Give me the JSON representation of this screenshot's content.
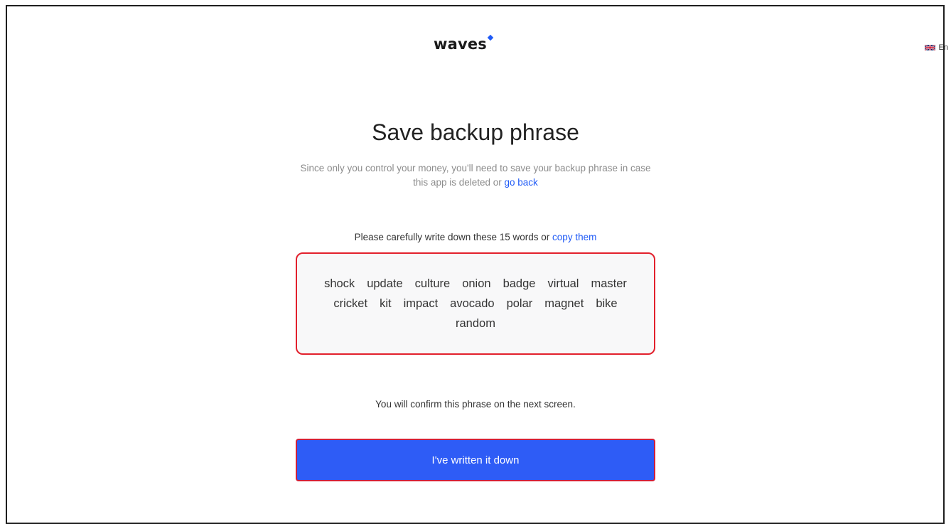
{
  "header": {
    "logo_text": "waves",
    "language": "En"
  },
  "main": {
    "title": "Save backup phrase",
    "subtitle_text": "Since only you control your money, you'll need to save your backup phrase in case this app is deleted or ",
    "subtitle_link": "go back",
    "instruction_text": "Please carefully write down these 15 words or ",
    "instruction_link": "copy them",
    "words": [
      "shock",
      "update",
      "culture",
      "onion",
      "badge",
      "virtual",
      "master",
      "cricket",
      "kit",
      "impact",
      "avocado",
      "polar",
      "magnet",
      "bike",
      "random"
    ],
    "confirm_note": "You will confirm this phrase on the next screen.",
    "primary_button": "I've written it down"
  },
  "colors": {
    "accent": "#1f5af6",
    "button": "#2e5cf6",
    "highlight_border": "#e2202c"
  }
}
